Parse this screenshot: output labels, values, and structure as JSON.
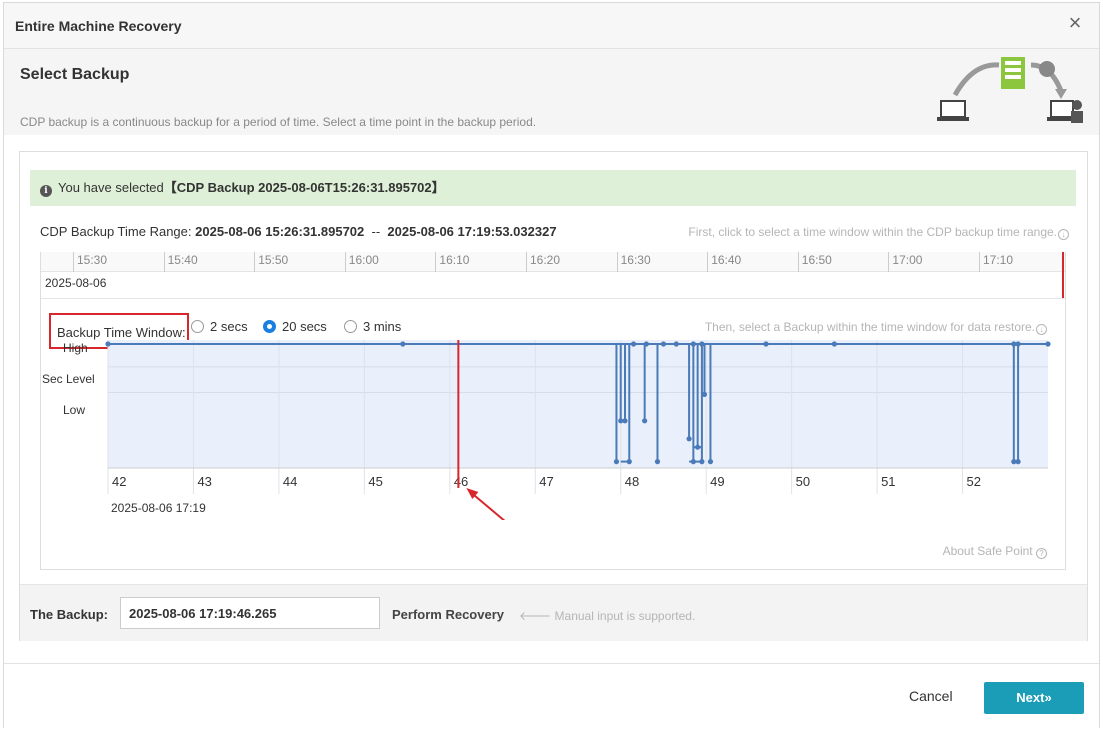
{
  "dialog": {
    "title": "Entire Machine Recovery",
    "close_glyph": "×"
  },
  "section": {
    "title": "Select Backup",
    "description": "CDP backup is a continuous backup for a period of time. Select a time point in the backup period."
  },
  "alert": {
    "prefix": "You have selected",
    "selection": "【CDP Backup 2025-08-06T15:26:31.895702】"
  },
  "range": {
    "label": "CDP Backup Time Range:",
    "start": "2025-08-06 15:26:31.895702",
    "separator": "--",
    "end": "2025-08-06 17:19:53.032327",
    "hint": "First, click to select a time window within the CDP backup time range."
  },
  "timeline": {
    "ticks": [
      "15:30",
      "15:40",
      "15:50",
      "16:00",
      "16:10",
      "16:20",
      "16:30",
      "16:40",
      "16:50",
      "17:00",
      "17:10"
    ],
    "date": "2025-08-06"
  },
  "window": {
    "label": "Backup Time Window:",
    "options": [
      {
        "label": "2 secs",
        "selected": false
      },
      {
        "label": "20 secs",
        "selected": true
      },
      {
        "label": "3 mins",
        "selected": false
      }
    ],
    "hint": "Then, select a Backup within the time window for data restore."
  },
  "chart_data": {
    "type": "line",
    "y_levels": [
      "High",
      "Sec Level",
      "Low"
    ],
    "x_ticks": [
      "42",
      "43",
      "44",
      "45",
      "46",
      "47",
      "48",
      "49",
      "50",
      "51",
      "52"
    ],
    "x_date_label": "2025-08-06 17:19",
    "x_range": [
      42,
      53
    ],
    "selected_x": 46.1,
    "series_color": "#4a7ab8",
    "high_points": [
      42.0,
      45.45,
      48.15,
      48.3,
      48.5,
      48.65,
      48.85,
      48.95,
      49.7,
      50.5,
      52.6,
      52.65,
      53.0
    ],
    "drops": [
      {
        "x": 47.95,
        "depth": 0.98
      },
      {
        "x": 48.0,
        "depth": 0.64
      },
      {
        "x": 48.05,
        "depth": 0.64
      },
      {
        "x": 48.1,
        "depth": 0.98
      },
      {
        "x": 48.28,
        "depth": 0.64
      },
      {
        "x": 48.43,
        "depth": 0.98
      },
      {
        "x": 48.8,
        "depth": 0.79
      },
      {
        "x": 48.85,
        "depth": 0.98
      },
      {
        "x": 48.9,
        "depth": 0.86
      },
      {
        "x": 48.95,
        "depth": 0.98
      },
      {
        "x": 48.98,
        "depth": 0.42
      },
      {
        "x": 49.05,
        "depth": 0.98
      },
      {
        "x": 52.6,
        "depth": 0.98
      },
      {
        "x": 52.65,
        "depth": 0.98
      }
    ]
  },
  "about": "About Safe Point",
  "backup": {
    "label": "The Backup:",
    "value": "2025-08-06 17:19:46.265",
    "perform": "Perform Recovery",
    "manual_hint": "Manual input is supported."
  },
  "footer": {
    "cancel": "Cancel",
    "next": "Next»"
  },
  "colors": {
    "accent": "#1b9db7",
    "alert_bg": "#dff0d8",
    "marker_red": "#d9262c",
    "radio_blue": "#1a7fe0"
  }
}
